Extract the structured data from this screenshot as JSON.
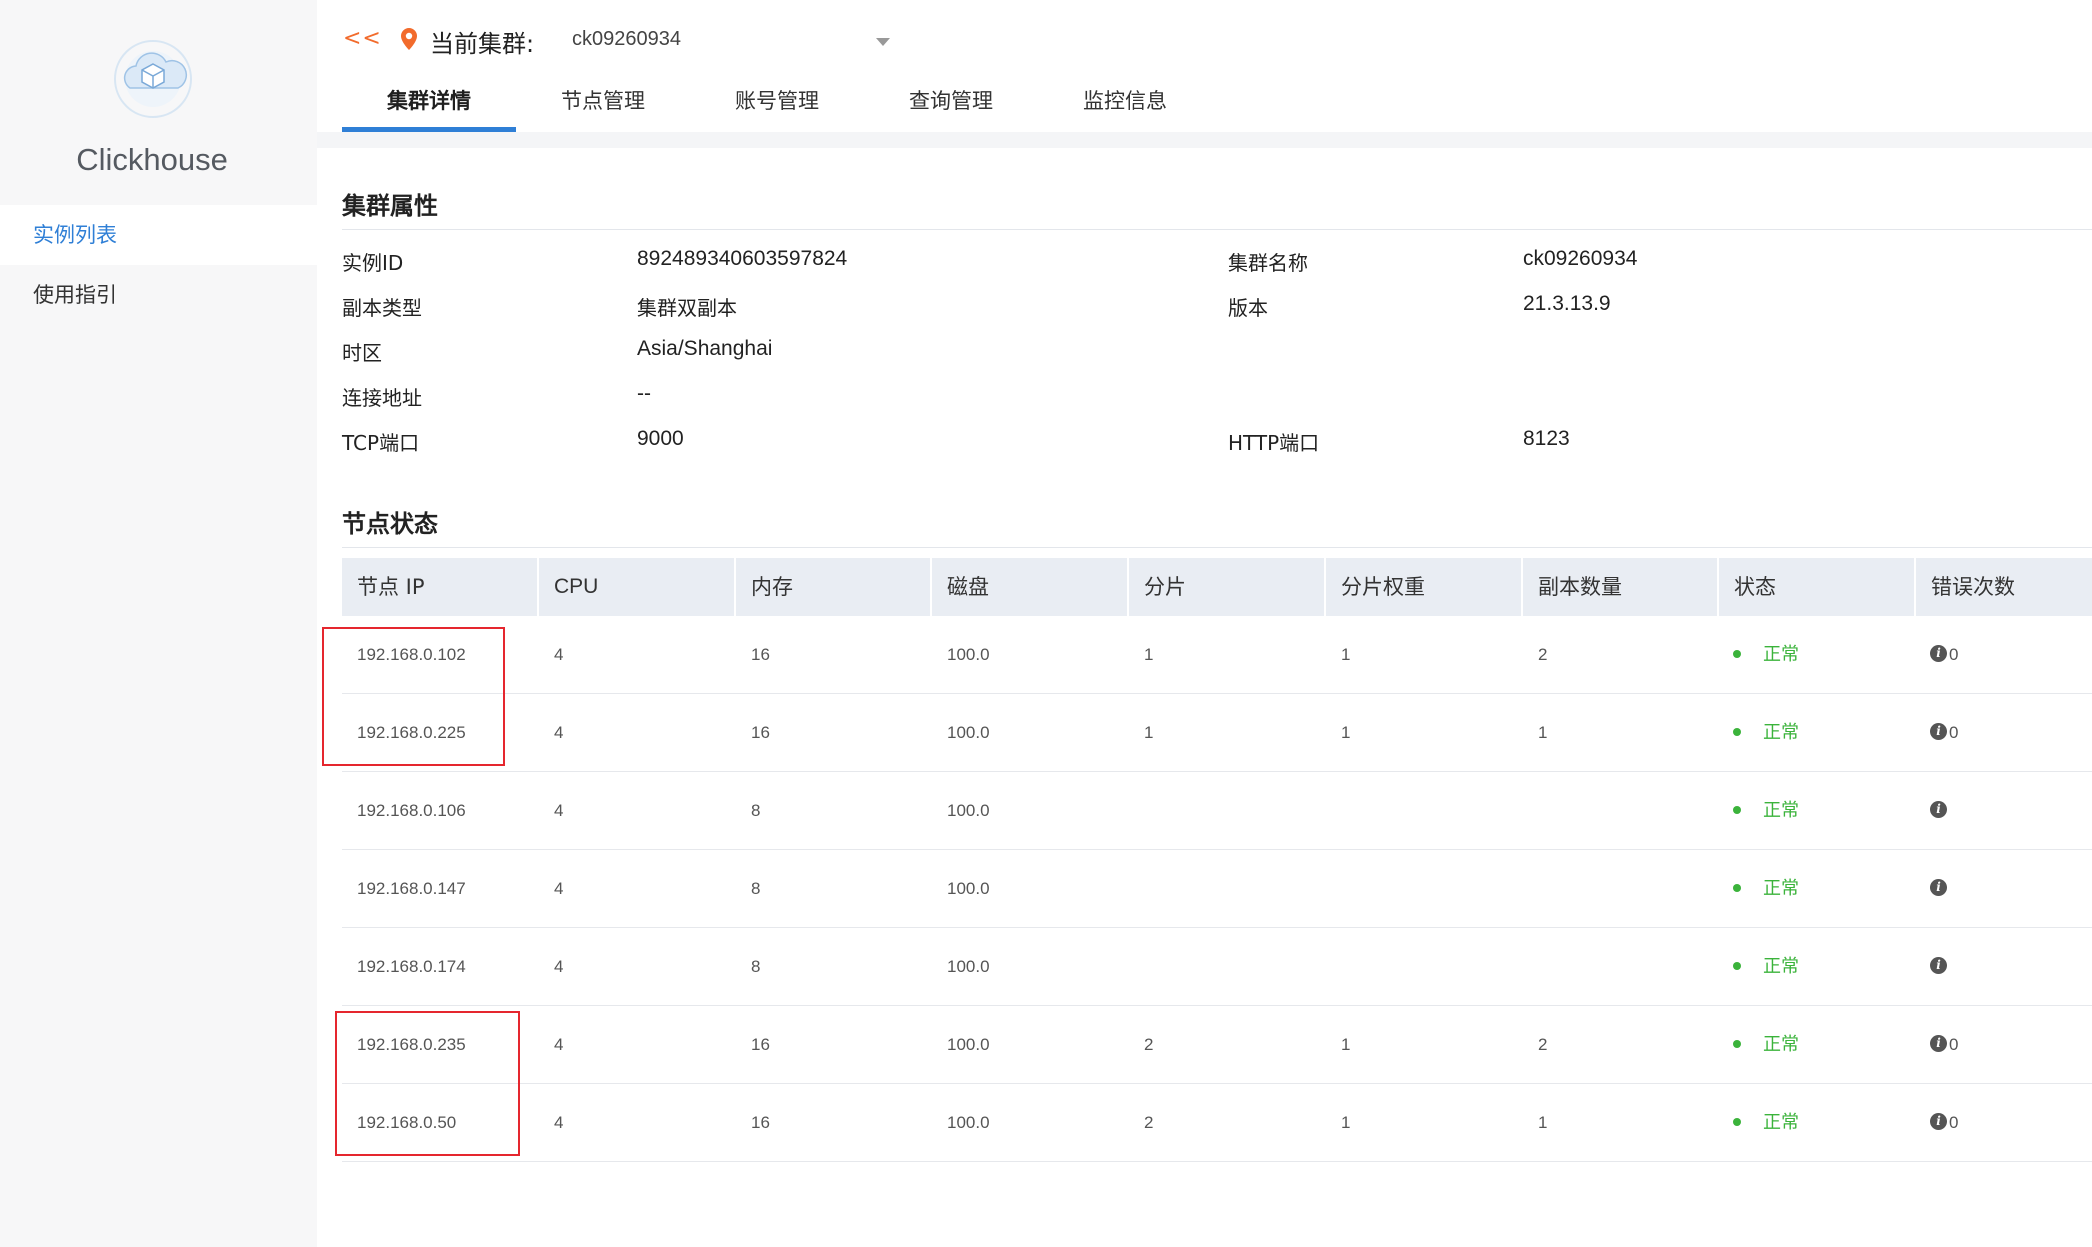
{
  "sidebar": {
    "brand": "Clickhouse",
    "items": [
      {
        "label": "实例列表",
        "active": true
      },
      {
        "label": "使用指引",
        "active": false
      }
    ]
  },
  "header": {
    "back": "<<",
    "cluster_label": "当前集群:",
    "cluster_value": "ck09260934",
    "tabs": [
      "集群详情",
      "节点管理",
      "账号管理",
      "查询管理",
      "监控信息"
    ],
    "active_tab": "集群详情"
  },
  "properties": {
    "title": "集群属性",
    "rows": [
      {
        "label": "实例ID",
        "value": "892489340603597824",
        "label2": "集群名称",
        "value2": "ck09260934"
      },
      {
        "label": "副本类型",
        "value": "集群双副本",
        "label2": "版本",
        "value2": "21.3.13.9"
      },
      {
        "label": "时区",
        "value": "Asia/Shanghai",
        "label2": "",
        "value2": ""
      },
      {
        "label": "连接地址",
        "value": "--",
        "label2": "",
        "value2": ""
      },
      {
        "label": "TCP端口",
        "value": "9000",
        "label2": "HTTP端口",
        "value2": "8123"
      }
    ]
  },
  "nodes": {
    "title": "节点状态",
    "columns": [
      "节点 IP",
      "CPU",
      "内存",
      "磁盘",
      "分片",
      "分片权重",
      "副本数量",
      "状态",
      "错误次数"
    ],
    "rows": [
      {
        "ip": "192.168.0.102",
        "cpu": "4",
        "mem": "16",
        "disk": "100.0",
        "shard": "1",
        "weight": "1",
        "replicas": "2",
        "status": "正常",
        "errors": "0"
      },
      {
        "ip": "192.168.0.225",
        "cpu": "4",
        "mem": "16",
        "disk": "100.0",
        "shard": "1",
        "weight": "1",
        "replicas": "1",
        "status": "正常",
        "errors": "0"
      },
      {
        "ip": "192.168.0.106",
        "cpu": "4",
        "mem": "8",
        "disk": "100.0",
        "shard": "",
        "weight": "",
        "replicas": "",
        "status": "正常",
        "errors": ""
      },
      {
        "ip": "192.168.0.147",
        "cpu": "4",
        "mem": "8",
        "disk": "100.0",
        "shard": "",
        "weight": "",
        "replicas": "",
        "status": "正常",
        "errors": ""
      },
      {
        "ip": "192.168.0.174",
        "cpu": "4",
        "mem": "8",
        "disk": "100.0",
        "shard": "",
        "weight": "",
        "replicas": "",
        "status": "正常",
        "errors": ""
      },
      {
        "ip": "192.168.0.235",
        "cpu": "4",
        "mem": "16",
        "disk": "100.0",
        "shard": "2",
        "weight": "1",
        "replicas": "2",
        "status": "正常",
        "errors": "0"
      },
      {
        "ip": "192.168.0.50",
        "cpu": "4",
        "mem": "16",
        "disk": "100.0",
        "shard": "2",
        "weight": "1",
        "replicas": "1",
        "status": "正常",
        "errors": "0"
      }
    ]
  },
  "icons": {
    "logo": "cloud-cube-logo",
    "location": "location-pin-icon",
    "dropdown": "chevron-down-icon",
    "info": "info-icon"
  },
  "colors": {
    "accent": "#2f7fd6",
    "back_link": "#f26b2c",
    "status_ok": "#3bb33b",
    "highlight": "#e5262e"
  }
}
